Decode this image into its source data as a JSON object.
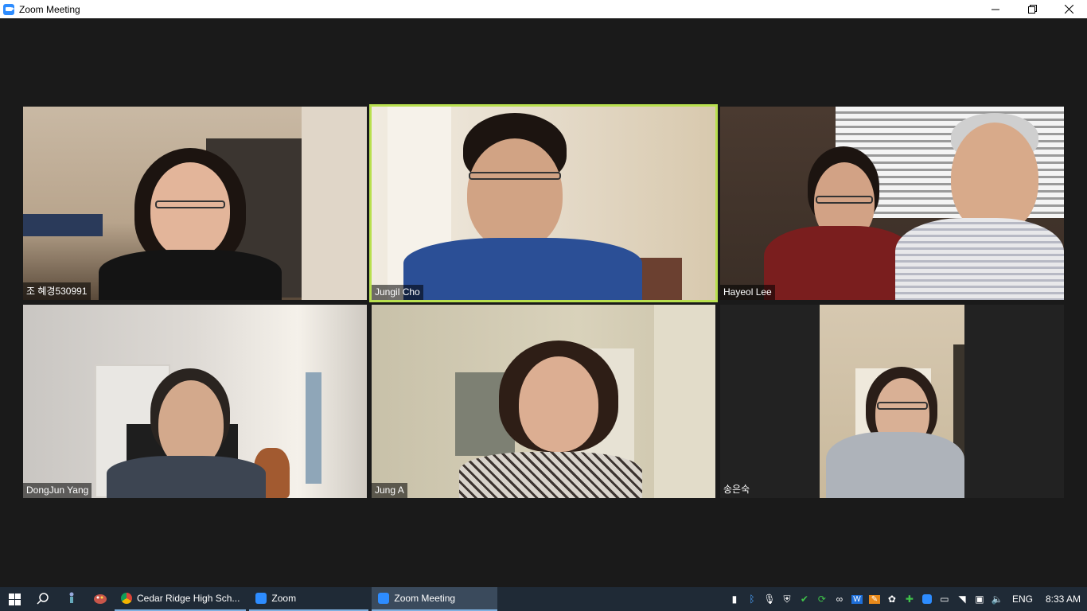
{
  "window": {
    "title": "Zoom Meeting",
    "minimize_icon": "minimize-icon",
    "restore_icon": "restore-icon",
    "close_icon": "close-icon"
  },
  "participants": [
    {
      "name": "조 혜경530991",
      "active": false
    },
    {
      "name": "Jungil Cho",
      "active": true
    },
    {
      "name": "Hayeol Lee",
      "active": false
    },
    {
      "name": "DongJun Yang",
      "active": false
    },
    {
      "name": "Jung A",
      "active": false
    },
    {
      "name": "송은숙",
      "active": false
    }
  ],
  "colors": {
    "active_speaker_border": "#b9e04f",
    "background": "#1a1a1a",
    "taskbar": "#1f2a36"
  },
  "taskbar": {
    "apps": [
      {
        "label": "Cedar Ridge High Sch...",
        "icon": "chrome-icon"
      },
      {
        "label": "Zoom",
        "icon": "zoom-icon"
      },
      {
        "label": "Zoom Meeting",
        "icon": "zoom-icon"
      }
    ],
    "language": "ENG",
    "time": "8:33 AM"
  }
}
